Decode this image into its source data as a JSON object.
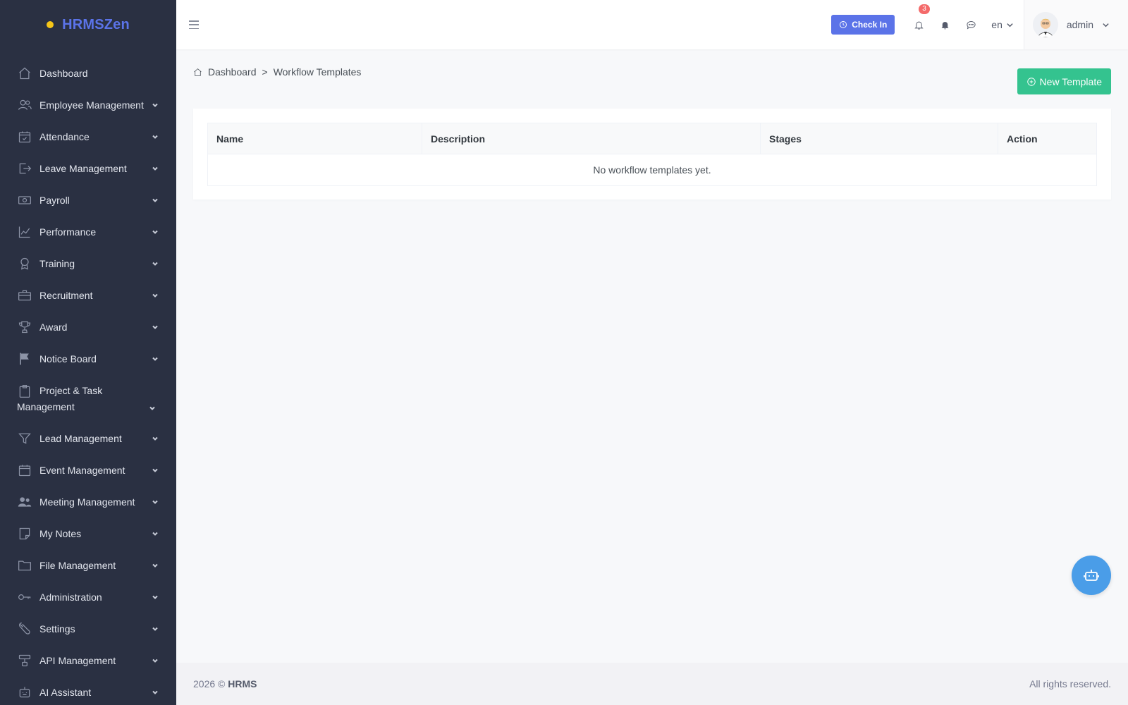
{
  "brand": {
    "name": "HRMSZen"
  },
  "sidebar": {
    "items": [
      {
        "label": "Dashboard",
        "icon": "home-icon",
        "expandable": false
      },
      {
        "label": "Employee Management",
        "icon": "users-icon",
        "expandable": true
      },
      {
        "label": "Attendance",
        "icon": "calendar-check-icon",
        "expandable": true
      },
      {
        "label": "Leave Management",
        "icon": "exit-icon",
        "expandable": true
      },
      {
        "label": "Payroll",
        "icon": "money-icon",
        "expandable": true
      },
      {
        "label": "Performance",
        "icon": "chart-line-icon",
        "expandable": true
      },
      {
        "label": "Training",
        "icon": "award-ribbon-icon",
        "expandable": true
      },
      {
        "label": "Recruitment",
        "icon": "briefcase-icon",
        "expandable": true
      },
      {
        "label": "Award",
        "icon": "trophy-icon",
        "expandable": true
      },
      {
        "label": "Notice Board",
        "icon": "flag-icon",
        "expandable": true
      },
      {
        "label": "Project & Task Management",
        "icon": "clipboard-icon",
        "expandable": true
      },
      {
        "label": "Lead Management",
        "icon": "funnel-icon",
        "expandable": true
      },
      {
        "label": "Event Management",
        "icon": "calendar-icon",
        "expandable": true
      },
      {
        "label": "Meeting Management",
        "icon": "people-icon",
        "expandable": true
      },
      {
        "label": "My Notes",
        "icon": "note-icon",
        "expandable": true
      },
      {
        "label": "File Management",
        "icon": "folder-icon",
        "expandable": true
      },
      {
        "label": "Administration",
        "icon": "key-icon",
        "expandable": true
      },
      {
        "label": "Settings",
        "icon": "wrench-icon",
        "expandable": true
      },
      {
        "label": "API Management",
        "icon": "network-icon",
        "expandable": true
      },
      {
        "label": "AI Assistant",
        "icon": "robot-icon",
        "expandable": true
      }
    ]
  },
  "topbar": {
    "checkin_label": "Check In",
    "notification_count": "3",
    "language": "en",
    "user_name": "admin"
  },
  "breadcrumb": {
    "home": "Dashboard",
    "separator": ">",
    "current": "Workflow Templates"
  },
  "actions": {
    "new_template_label": "New Template"
  },
  "table": {
    "headers": [
      "Name",
      "Description",
      "Stages",
      "Action"
    ],
    "empty_message": "No workflow templates yet."
  },
  "footer": {
    "year": "2026 ©",
    "brand": "HRMS",
    "rights": "All rights reserved."
  },
  "colors": {
    "sidebar_bg": "#2a3042",
    "brand": "#5b73e8",
    "primary": "#5b73e8",
    "success": "#34c38f",
    "badge": "#f46a6a",
    "fab": "#4a9de8"
  }
}
